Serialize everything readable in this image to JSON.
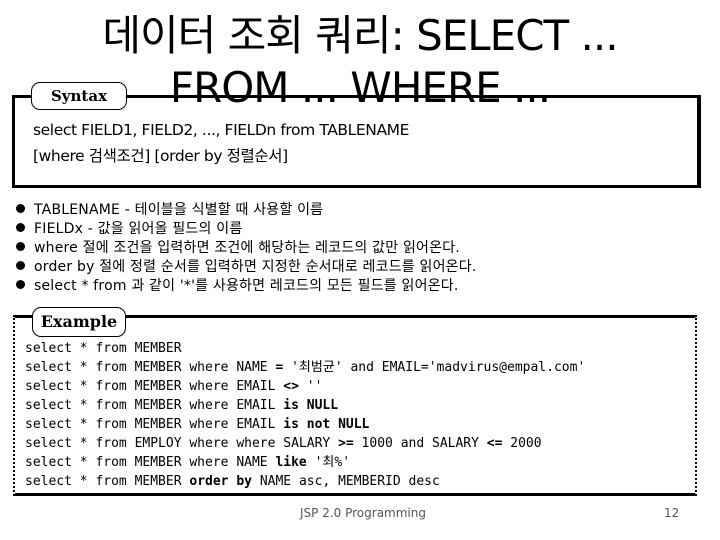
{
  "title": {
    "line1": "데이터 조회 쿼리: SELECT ...",
    "line2": "FROM ... WHERE ..."
  },
  "syntax": {
    "label": "Syntax",
    "line1": "select FIELD1, FIELD2, ..., FIELDn from TABLENAME",
    "line2": "[where 검색조건] [order by 정렬순서]"
  },
  "bullets": [
    "TABLENAME - 테이블을 식별할 때 사용할 이름",
    "FIELDx - 값을 읽어올 필드의 이름",
    "where 절에 조건을 입력하면 조건에 해당하는 레코드의 값만 읽어온다.",
    "order by 절에 정렬 순서를 입력하면 지정한 순서대로 레코드를 읽어온다.",
    "select * from 과 같이 '*'를 사용하면 레코드의 모든 필드를 읽어온다."
  ],
  "example": {
    "label": "Example",
    "rows": [
      {
        "pre": "select * from MEMBER",
        "kw": "",
        "post": ""
      },
      {
        "pre": "select * from MEMBER where NAME ",
        "kw": "=",
        "post": " '최범균' and EMAIL='madvirus@empal.com'"
      },
      {
        "pre": "select * from MEMBER where EMAIL ",
        "kw": "<>",
        "post": " ''"
      },
      {
        "pre": "select * from MEMBER where EMAIL ",
        "kw": "is NULL",
        "post": ""
      },
      {
        "pre": "select * from MEMBER where EMAIL ",
        "kw": "is not NULL",
        "post": ""
      },
      {
        "pre": "select * from EMPLOY where where SALARY ",
        "kw": ">=",
        "post": " 1000 and SALARY ",
        "kw2": "<=",
        "post2": " 2000"
      },
      {
        "pre": "select * from MEMBER where NAME ",
        "kw": "like",
        "post": " '최%'"
      },
      {
        "pre": "select * from MEMBER ",
        "kw": "order by",
        "post": " NAME asc, MEMBERID desc"
      }
    ]
  },
  "footer": {
    "title": "JSP 2.0 Programming",
    "page": "12"
  }
}
